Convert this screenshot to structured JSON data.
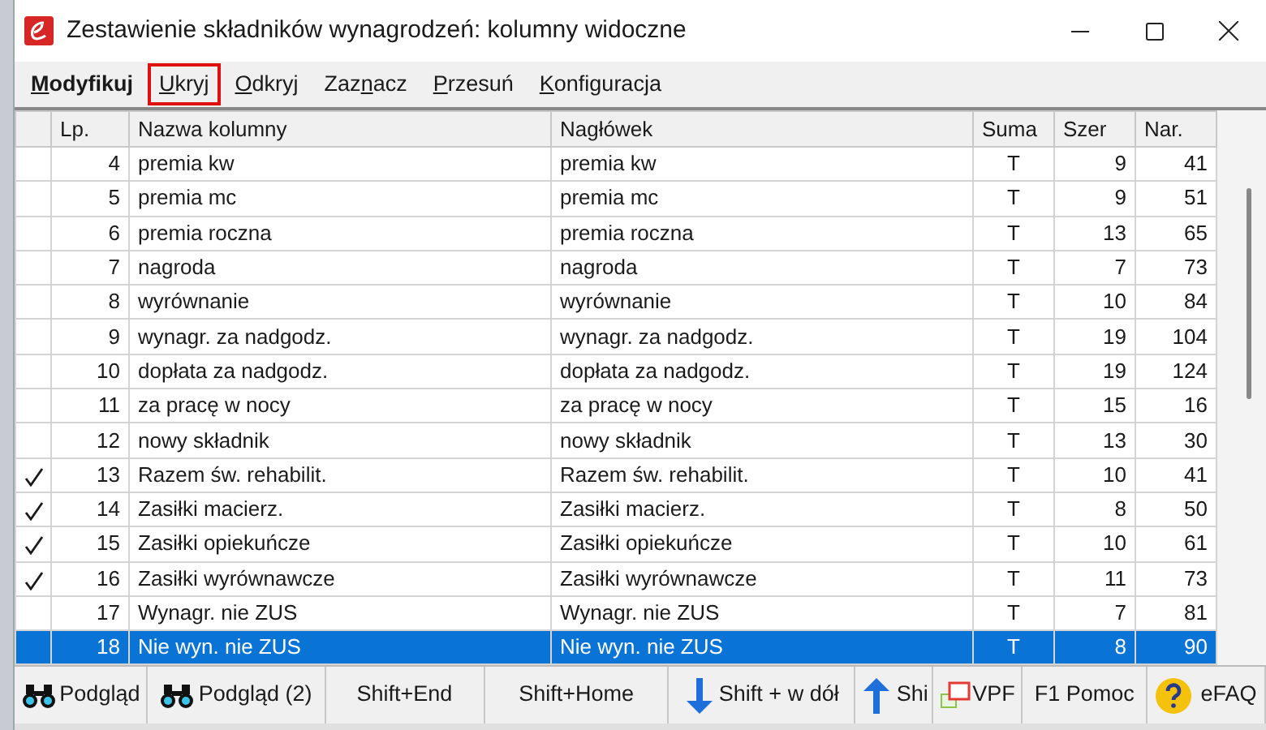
{
  "window": {
    "title": "Zestawienie składników wynagrodzeń: kolumny widoczne"
  },
  "menu": [
    {
      "mnemonic": "M",
      "after": "odyfikuj",
      "active": true,
      "highlighted": false
    },
    {
      "mnemonic": "U",
      "after": "kryj",
      "active": false,
      "highlighted": true
    },
    {
      "mnemonic": "O",
      "after": "dkryj",
      "active": false,
      "highlighted": false
    },
    {
      "before": "Zaz",
      "mnemonic": "n",
      "after": "acz",
      "active": false,
      "highlighted": false
    },
    {
      "mnemonic": "P",
      "after": "rzesuń",
      "active": false,
      "highlighted": false
    },
    {
      "mnemonic": "K",
      "after": "onfiguracja",
      "active": false,
      "highlighted": false
    }
  ],
  "table": {
    "columns": [
      "Lp.",
      "Nazwa kolumny",
      "Nagłówek",
      "Suma",
      "Szer",
      "Nar."
    ],
    "rows": [
      {
        "checked": false,
        "selected": false,
        "cells": [
          "4",
          "premia kw",
          "premia kw",
          "T",
          "9",
          "41"
        ]
      },
      {
        "checked": false,
        "selected": false,
        "cells": [
          "5",
          "premia mc",
          "premia mc",
          "T",
          "9",
          "51"
        ]
      },
      {
        "checked": false,
        "selected": false,
        "cells": [
          "6",
          "premia roczna",
          "premia roczna",
          "T",
          "13",
          "65"
        ]
      },
      {
        "checked": false,
        "selected": false,
        "cells": [
          "7",
          "nagroda",
          "nagroda",
          "T",
          "7",
          "73"
        ]
      },
      {
        "checked": false,
        "selected": false,
        "cells": [
          "8",
          "wyrównanie",
          "wyrównanie",
          "T",
          "10",
          "84"
        ]
      },
      {
        "checked": false,
        "selected": false,
        "cells": [
          "9",
          "wynagr. za nadgodz.",
          "wynagr. za nadgodz.",
          "T",
          "19",
          "104"
        ]
      },
      {
        "checked": false,
        "selected": false,
        "cells": [
          "10",
          "dopłata za nadgodz.",
          "dopłata za nadgodz.",
          "T",
          "19",
          "124"
        ]
      },
      {
        "checked": false,
        "selected": false,
        "cells": [
          "11",
          "za pracę w nocy",
          "za pracę w nocy",
          "T",
          "15",
          "16"
        ]
      },
      {
        "checked": false,
        "selected": false,
        "cells": [
          "12",
          "nowy składnik",
          "nowy składnik",
          "T",
          "13",
          "30"
        ]
      },
      {
        "checked": true,
        "selected": false,
        "cells": [
          "13",
          "Razem św. rehabilit.",
          "Razem św. rehabilit.",
          "T",
          "10",
          "41"
        ]
      },
      {
        "checked": true,
        "selected": false,
        "cells": [
          "14",
          "Zasiłki macierz.",
          "Zasiłki macierz.",
          "T",
          "8",
          "50"
        ]
      },
      {
        "checked": true,
        "selected": false,
        "cells": [
          "15",
          "Zasiłki opiekuńcze",
          "Zasiłki opiekuńcze",
          "T",
          "10",
          "61"
        ]
      },
      {
        "checked": true,
        "selected": false,
        "cells": [
          "16",
          "Zasiłki wyrównawcze",
          "Zasiłki wyrównawcze",
          "T",
          "11",
          "73"
        ]
      },
      {
        "checked": false,
        "selected": false,
        "cells": [
          "17",
          "Wynagr. nie ZUS",
          "Wynagr. nie ZUS",
          "T",
          "7",
          "81"
        ]
      },
      {
        "checked": false,
        "selected": true,
        "cells": [
          "18",
          "Nie wyn. nie ZUS",
          "Nie wyn. nie ZUS",
          "T",
          "8",
          "90"
        ]
      }
    ]
  },
  "buttons": [
    {
      "label": "Podgląd",
      "kind": "binoculars"
    },
    {
      "label": "Podgląd (2)",
      "kind": "binoculars"
    },
    {
      "label": "Shift+End",
      "kind": "plain"
    },
    {
      "label": "Shift+Home",
      "kind": "plain"
    },
    {
      "label": "Shift + w dół",
      "kind": "down"
    },
    {
      "label": "Shi",
      "kind": "up"
    },
    {
      "label": "VPF",
      "kind": "windows"
    },
    {
      "label": "F1 Pomoc",
      "kind": "plain"
    },
    {
      "label": "eFAQ",
      "kind": "help"
    }
  ]
}
